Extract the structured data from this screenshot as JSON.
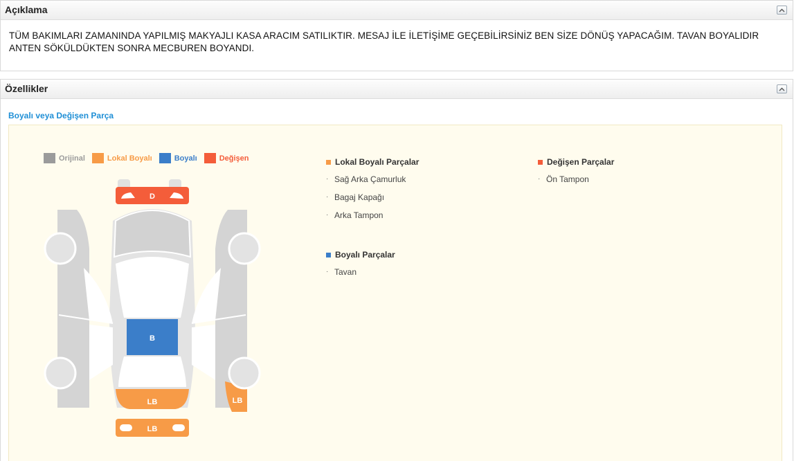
{
  "description_section": {
    "title": "Açıklama",
    "text": "TÜM BAKIMLARI ZAMANINDA YAPILMIŞ MAKYAJLI KASA ARACIM SATILIKTIR. MESAJ İLE İLETİŞİME GEÇEBİLİRSİNİZ BEN SİZE DÖNÜŞ YAPACAĞIM. TAVAN BOYALIDIR ANTEN SÖKÜLDÜKTEN SONRA MECBUREN BOYANDI."
  },
  "features_section": {
    "title": "Özellikler",
    "painted_link": "Boyalı veya Değişen Parça"
  },
  "legend": [
    {
      "label": "Orijinal",
      "color": "#9b9b9b"
    },
    {
      "label": "Lokal Boyalı",
      "color": "#f79b47"
    },
    {
      "label": "Boyalı",
      "color": "#3b7ec9"
    },
    {
      "label": "Değişen",
      "color": "#f45d3a"
    }
  ],
  "car_labels": {
    "front_bumper": "D",
    "roof": "B",
    "trunk": "LB",
    "rear_bumper": "LB",
    "right_rear_fender": "LB"
  },
  "colors": {
    "original": "#d7d7d7",
    "local_painted": "#f79b47",
    "painted": "#3b7ec9",
    "changed": "#f45d3a",
    "wheel": "#e3e3e3"
  },
  "local_painted_parts": {
    "title": "Lokal Boyalı Parçalar",
    "items": [
      "Sağ Arka Çamurluk",
      "Bagaj Kapağı",
      "Arka Tampon"
    ]
  },
  "painted_parts": {
    "title": "Boyalı Parçalar",
    "items": [
      "Tavan"
    ]
  },
  "changed_parts": {
    "title": "Değişen Parçalar",
    "items": [
      "Ön Tampon"
    ]
  }
}
